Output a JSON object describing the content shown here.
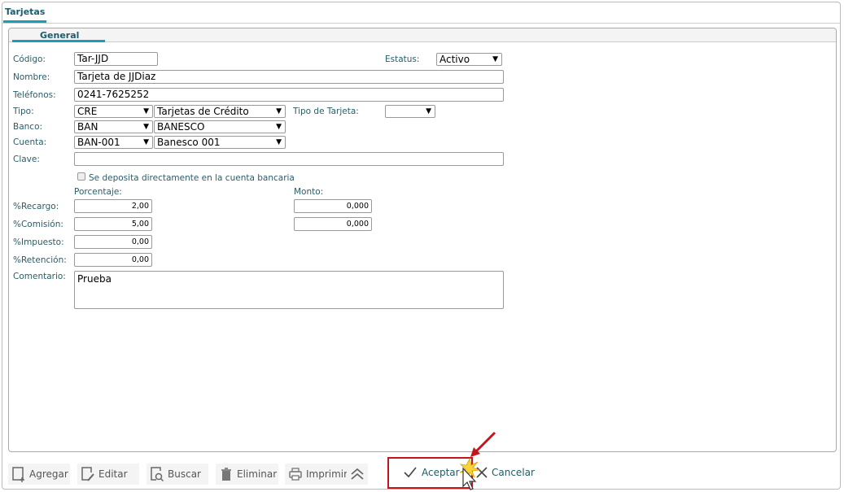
{
  "window": {
    "tab": "Tarjetas",
    "subtab": "General"
  },
  "form": {
    "codigo": {
      "label": "Código:",
      "value": "Tar-JJD"
    },
    "estatus": {
      "label": "Estatus:",
      "value": "Activo"
    },
    "nombre": {
      "label": "Nombre:",
      "value": "Tarjeta de JJDiaz"
    },
    "telefonos": {
      "label": "Teléfonos:",
      "value": "0241-7625252"
    },
    "tipo": {
      "label": "Tipo:",
      "code": "CRE",
      "desc": "Tarjetas de Crédito"
    },
    "tipo_tarjeta": {
      "label": "Tipo de Tarjeta:",
      "value": ""
    },
    "banco": {
      "label": "Banco:",
      "code": "BAN",
      "desc": "BANESCO"
    },
    "cuenta": {
      "label": "Cuenta:",
      "code": "BAN-001",
      "desc": "Banesco 001"
    },
    "clave": {
      "label": "Clave:",
      "value": ""
    },
    "deposito": {
      "label": "Se deposita directamente en la cuenta bancaria",
      "checked": false
    },
    "porcentaje_header": "Porcentaje:",
    "monto_header": "Monto:",
    "recargo": {
      "label": "%Recargo:",
      "pct": "2,00",
      "monto": "0,000"
    },
    "comision": {
      "label": "%Comisión:",
      "pct": "5,00",
      "monto": "0,000"
    },
    "impuesto": {
      "label": "%Impuesto:",
      "pct": "0,00"
    },
    "retencion": {
      "label": "%Retención:",
      "pct": "0,00"
    },
    "comentario": {
      "label": "Comentario:",
      "value": "Prueba"
    }
  },
  "toolbar": {
    "agregar": "Agregar",
    "editar": "Editar",
    "buscar": "Buscar",
    "eliminar": "Eliminar",
    "imprimir": "Imprimir",
    "aceptar": "Aceptar",
    "cancelar": "Cancelar"
  },
  "colors": {
    "accent": "#17a0b3",
    "label": "#2b5c66",
    "highlight": "#c0161c"
  }
}
